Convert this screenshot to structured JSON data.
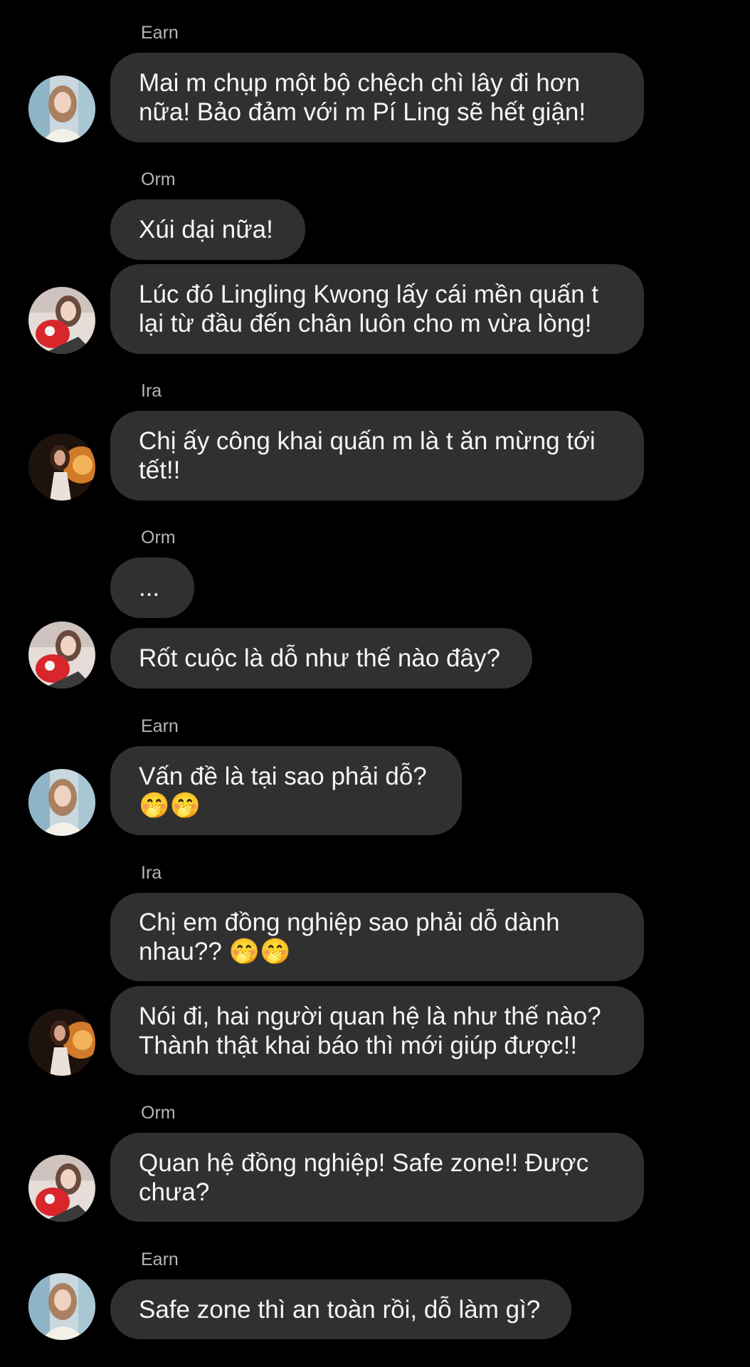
{
  "colors": {
    "background": "#000000",
    "bubble": "#303030",
    "sender_name": "#b5b5b5",
    "text": "#f5f5f5"
  },
  "messages": [
    {
      "sender": "Earn",
      "text": "Mai m chụp một bộ chệch chì lây đi hơn\nnữa! Bảo đảm với m Pí Ling sẽ hết giận!",
      "avatar": "earn-avatar"
    },
    {
      "sender": "Orm",
      "text": "Xúi dại nữa!",
      "avatar": ""
    },
    {
      "sender": "",
      "text": "Lúc đó Lingling Kwong lấy cái mền quấn t\nlại từ đầu đến chân luôn cho m vừa lòng!",
      "avatar": "orm-avatar"
    },
    {
      "sender": "Ira",
      "text": "Chị ấy công khai quấn m là t ăn mừng tới\ntết!!",
      "avatar": "ira-avatar"
    },
    {
      "sender": "Orm",
      "text": "...",
      "avatar": ""
    },
    {
      "sender": "",
      "text": "Rốt cuộc là dỗ như thế nào đây?",
      "avatar": "orm-avatar"
    },
    {
      "sender": "Earn",
      "text": "Vấn đề là tại sao phải dỗ?\n🤭🤭",
      "avatar": "earn-avatar"
    },
    {
      "sender": "Ira",
      "text": "Chị em đồng nghiệp sao phải dỗ dành\nnhau?? 🤭🤭",
      "avatar": ""
    },
    {
      "sender": "",
      "text": "Nói đi, hai người quan hệ là như thế nào?\nThành thật khai báo thì mới giúp được!!",
      "avatar": "ira-avatar"
    },
    {
      "sender": "Orm",
      "text": "Quan hệ đồng nghiệp! Safe zone!! Được\nchưa?",
      "avatar": "orm-avatar"
    },
    {
      "sender": "Earn",
      "text": "Safe zone thì an toàn rồi, dỗ làm gì?",
      "avatar": "earn-avatar"
    }
  ]
}
